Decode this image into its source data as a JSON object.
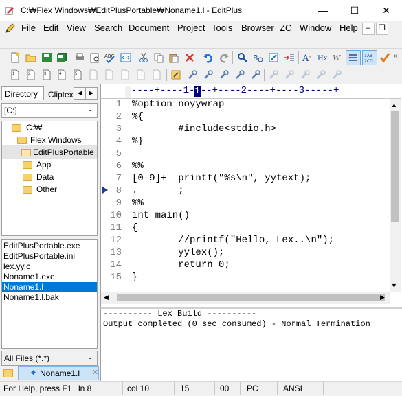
{
  "window": {
    "title": "C:₩Flex Windows₩EditPlusPortable₩Noname1.l - EditPlus",
    "controls": {
      "minimize": "—",
      "maximize": "☐",
      "close": "✕"
    }
  },
  "menu": {
    "items": [
      {
        "label": "File"
      },
      {
        "label": "Edit"
      },
      {
        "label": "View"
      },
      {
        "label": "Search"
      },
      {
        "label": "Document"
      },
      {
        "label": "Project"
      },
      {
        "label": "Tools"
      },
      {
        "label": "Browser"
      },
      {
        "label": "ZC"
      },
      {
        "label": "Window"
      },
      {
        "label": "Help"
      }
    ],
    "mdi_minimize": "–",
    "mdi_restore": "❐"
  },
  "sidebar": {
    "tabs": [
      {
        "label": "Directory"
      },
      {
        "label": "Cliptex"
      }
    ],
    "drive": "[C:]",
    "tree": [
      {
        "label": "C:₩"
      },
      {
        "label": "Flex Windows"
      },
      {
        "label": "EditPlusPortable"
      },
      {
        "label": "App"
      },
      {
        "label": "Data"
      },
      {
        "label": "Other"
      }
    ],
    "files": [
      {
        "label": "EditPlusPortable.exe"
      },
      {
        "label": "EditPlusPortable.ini"
      },
      {
        "label": "lex.yy.c"
      },
      {
        "label": "Noname1.exe"
      },
      {
        "label": "Noname1.l"
      },
      {
        "label": "Noname1.l.bak"
      }
    ],
    "filter": "All Files (*.*)"
  },
  "ruler": {
    "text": "----+----1----+----2----+----3-----+",
    "labels": [
      "1",
      "2",
      "3"
    ]
  },
  "editor": {
    "lines": [
      {
        "num": "1",
        "text": "%option noyywrap"
      },
      {
        "num": "2",
        "text": "%{"
      },
      {
        "num": "3",
        "text": "        #include<stdio.h>"
      },
      {
        "num": "4",
        "text": "%}"
      },
      {
        "num": "5",
        "text": ""
      },
      {
        "num": "6",
        "text": "%%"
      },
      {
        "num": "7",
        "text": "[0-9]+  printf(\"%s\\n\", yytext);"
      },
      {
        "num": "8",
        "text": ".       ;"
      },
      {
        "num": "9",
        "text": "%%"
      },
      {
        "num": "10",
        "text": "int main()"
      },
      {
        "num": "11",
        "text": "{"
      },
      {
        "num": "12",
        "text": "        //printf(\"Hello, Lex..\\n\");"
      },
      {
        "num": "13",
        "text": "        yylex();"
      },
      {
        "num": "14",
        "text": "        return 0;"
      },
      {
        "num": "15",
        "text": "}"
      }
    ]
  },
  "output": {
    "lines": [
      "---------- Lex Build ----------",
      "Output completed (0 sec consumed) - Normal Termination"
    ]
  },
  "document_tab": {
    "label": "Noname1.l"
  },
  "status": {
    "help": "For Help, press F1",
    "line": "ln 8",
    "col": "col 10",
    "c1": "15",
    "c2": "00",
    "mode": "PC",
    "encoding": "ANSI"
  },
  "colors": {
    "selection": "#0078d7",
    "gutter_marker": "#1f3b8f",
    "ruler_bg": "#ffffff"
  }
}
